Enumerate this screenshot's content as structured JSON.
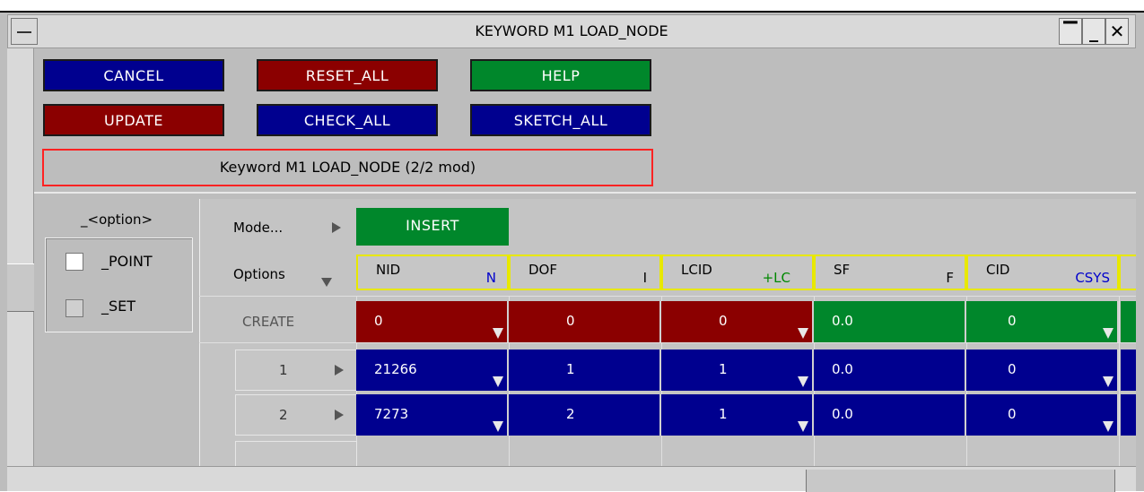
{
  "window": {
    "title": "KEYWORD M1 LOAD_NODE"
  },
  "buttons": {
    "cancel": "CANCEL",
    "reset_all": "RESET_ALL",
    "help": "HELP",
    "update": "UPDATE",
    "check_all": "CHECK_ALL",
    "sketch_all": "SKETCH_ALL"
  },
  "status": "Keyword M1 LOAD_NODE (2/2 mod)",
  "options": {
    "title": "_<option>",
    "items": [
      {
        "label": "_POINT",
        "checked": false
      },
      {
        "label": "_SET",
        "checked": false
      }
    ]
  },
  "mode": {
    "label": "Mode...",
    "value": "INSERT"
  },
  "options_label": "Options",
  "columns": [
    {
      "name": "NID",
      "tag": "N",
      "tag_color": "#0000cc"
    },
    {
      "name": "DOF",
      "tag": "I",
      "tag_color": "#000000"
    },
    {
      "name": "LCID",
      "tag": "+LC",
      "tag_color": "#008800"
    },
    {
      "name": "SF",
      "tag": "F",
      "tag_color": "#000000"
    },
    {
      "name": "CID",
      "tag": "CSYS",
      "tag_color": "#0000cc"
    }
  ],
  "create": {
    "label": "CREATE",
    "values": [
      "0",
      "0",
      "0",
      "0.0",
      "0"
    ]
  },
  "rows": [
    {
      "index": "1",
      "values": [
        "21266",
        "1",
        "1",
        "0.0",
        "0"
      ]
    },
    {
      "index": "2",
      "values": [
        "7273",
        "2",
        "1",
        "0.0",
        "0"
      ]
    }
  ],
  "colors": {
    "blue": "#00008f",
    "red": "#8b0000",
    "green": "#00872b",
    "status_border": "#ff2222",
    "header_border": "#e8e800"
  }
}
